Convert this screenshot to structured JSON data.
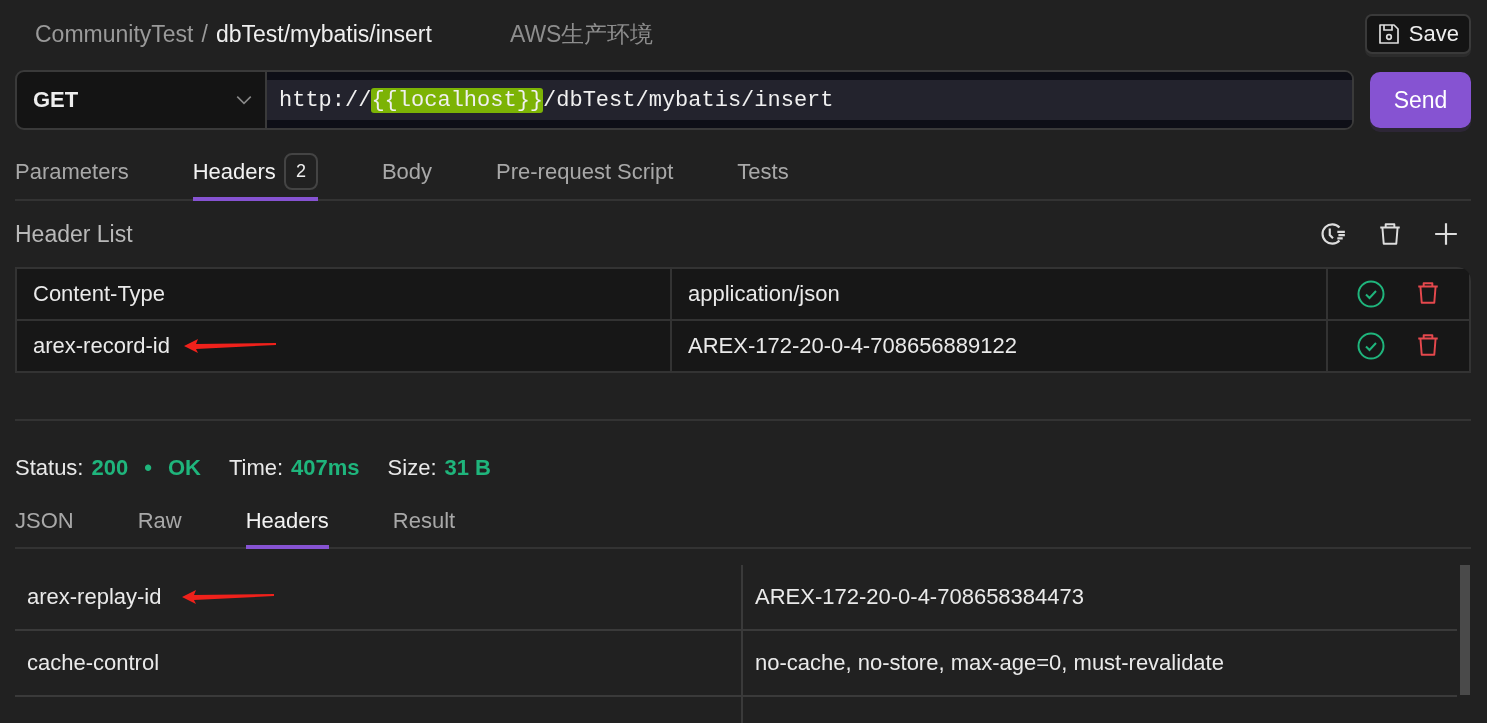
{
  "breadcrumb": {
    "workspace": "CommunityTest",
    "separator": "/",
    "path": "dbTest/mybatis/insert"
  },
  "environment": "AWS生产环境",
  "save_button": "Save",
  "request": {
    "method": "GET",
    "url_parts": [
      {
        "kind": "text",
        "text": "http://"
      },
      {
        "kind": "variable",
        "text": "{{localhost}}"
      },
      {
        "kind": "text",
        "text": "/dbTest/mybatis/insert"
      }
    ],
    "send_button": "Send"
  },
  "request_tabs": [
    {
      "label": "Parameters",
      "selected": false
    },
    {
      "label": "Headers",
      "badge": "2",
      "selected": true
    },
    {
      "label": "Body",
      "selected": false
    },
    {
      "label": "Pre-request Script",
      "selected": false
    },
    {
      "label": "Tests",
      "selected": false
    }
  ],
  "header_list": {
    "title": "Header List",
    "rows": [
      {
        "key": "Content-Type",
        "value": "application/json",
        "enabled": true,
        "annotated": false
      },
      {
        "key": "arex-record-id",
        "value": "AREX-172-20-0-4-708656889122",
        "enabled": true,
        "annotated": true
      }
    ]
  },
  "response": {
    "status": {
      "label": "Status:",
      "code": "200",
      "separator": "•",
      "text": "OK"
    },
    "time": {
      "label": "Time:",
      "value": "407ms"
    },
    "size": {
      "label": "Size:",
      "value": "31 B"
    },
    "tabs": [
      {
        "label": "JSON",
        "selected": false
      },
      {
        "label": "Raw",
        "selected": false
      },
      {
        "label": "Headers",
        "selected": true
      },
      {
        "label": "Result",
        "selected": false
      }
    ],
    "headers": [
      {
        "key": "arex-replay-id",
        "value": "AREX-172-20-0-4-708658384473",
        "annotated": true
      },
      {
        "key": "cache-control",
        "value": "no-cache, no-store, max-age=0, must-revalidate",
        "annotated": false
      }
    ]
  }
}
